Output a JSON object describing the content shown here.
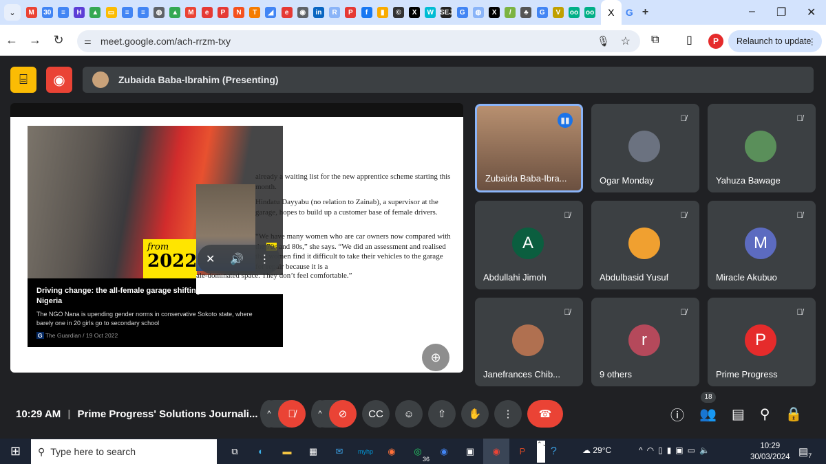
{
  "browser": {
    "tab_favicons": [
      {
        "icon": "gmail-icon",
        "glyph": "M",
        "color": "#ea4335"
      },
      {
        "icon": "calendar-icon",
        "glyph": "30",
        "color": "#4285f4"
      },
      {
        "icon": "docs-icon",
        "glyph": "≡",
        "color": "#4285f4"
      },
      {
        "icon": "app-icon",
        "glyph": "H",
        "color": "#5c3dd6"
      },
      {
        "icon": "drive-icon",
        "glyph": "▲",
        "color": "#34a853"
      },
      {
        "icon": "slides-icon",
        "glyph": "▭",
        "color": "#fbbc04"
      },
      {
        "icon": "docs-icon",
        "glyph": "≡",
        "color": "#4285f4"
      },
      {
        "icon": "docs-icon",
        "glyph": "≡",
        "color": "#4285f4"
      },
      {
        "icon": "globe-icon",
        "glyph": "◍",
        "color": "#5f6368"
      },
      {
        "icon": "drive-icon",
        "glyph": "▲",
        "color": "#34a853"
      },
      {
        "icon": "gmail-icon",
        "glyph": "M",
        "color": "#ea4335"
      },
      {
        "icon": "e-icon",
        "glyph": "e",
        "color": "#e53935"
      },
      {
        "icon": "p-icon",
        "glyph": "P",
        "color": "#e53935"
      },
      {
        "icon": "n-icon",
        "glyph": "N",
        "color": "#f4511e"
      },
      {
        "icon": "t-icon",
        "glyph": "T",
        "color": "#f57c00"
      },
      {
        "icon": "ads-icon",
        "glyph": "◢",
        "color": "#4285f4"
      },
      {
        "icon": "e-icon",
        "glyph": "e",
        "color": "#e53935"
      },
      {
        "icon": "chrome-icon",
        "glyph": "◉",
        "color": "#5f6368"
      },
      {
        "icon": "linkedin-icon",
        "glyph": "in",
        "color": "#0a66c2"
      },
      {
        "icon": "r-icon",
        "glyph": "R",
        "color": "#8ab4f8"
      },
      {
        "icon": "p-icon",
        "glyph": "P",
        "color": "#e53935"
      },
      {
        "icon": "facebook-icon",
        "glyph": "f",
        "color": "#1877f2"
      },
      {
        "icon": "analytics-icon",
        "glyph": "▮",
        "color": "#f9ab00"
      },
      {
        "icon": "c-icon",
        "glyph": "©",
        "color": "#333"
      },
      {
        "icon": "x-icon",
        "glyph": "X",
        "color": "#000"
      },
      {
        "icon": "bluesky-icon",
        "glyph": "W",
        "color": "#00bcd4"
      },
      {
        "icon": "sej-icon",
        "glyph": "SEJ",
        "color": "#222"
      },
      {
        "icon": "google-icon",
        "glyph": "G",
        "color": "#4285f4"
      },
      {
        "icon": "globe-icon",
        "glyph": "◍",
        "color": "#8ab4f8"
      },
      {
        "icon": "x-icon",
        "glyph": "X",
        "color": "#000"
      },
      {
        "icon": "pen-icon",
        "glyph": "/",
        "color": "#7cb342"
      },
      {
        "icon": "tree-icon",
        "glyph": "♣",
        "color": "#555"
      },
      {
        "icon": "google-icon",
        "glyph": "G",
        "color": "#4285f4"
      },
      {
        "icon": "v-icon",
        "glyph": "V",
        "color": "#c0a000"
      },
      {
        "icon": "tripadvisor-icon",
        "glyph": "oo",
        "color": "#00af87"
      },
      {
        "icon": "tripadvisor-icon",
        "glyph": "oo",
        "color": "#00af87"
      }
    ],
    "active_tab_close": "X",
    "next_tab_favicon": "G",
    "new_tab": "+",
    "url": "meet.google.com/ach-rrzm-txy",
    "relaunch_label": "Relaunch to update",
    "profile_initial": "P"
  },
  "meet": {
    "presenter_label": "Zubaida Baba-Ibrahim (Presenting)",
    "slide": {
      "badge_from": "from",
      "badge_year": "2022",
      "card_title": "Driving change: the all-female garage shifting attitudes in northern Nigeria",
      "card_desc": "The NGO Nana is upending gender norms in conservative Sokoto state, where barely one in 20 girls go to secondary school",
      "card_source": "The Guardian / 19 Oct 2022",
      "para1": "already a waiting list for the new apprentice scheme starting this month.",
      "para2": "Hindatu Dayyabu (no relation to Zainab), a supervisor at the garage, hopes to build up a customer base of female drivers.",
      "para3_a": "“We have many women who are car owners now compared with the ",
      "para3_highlight": "70s",
      "para3_b": " and 80s,” she says. “We did an assessment and realised that women find it difficult to take their vehicles to the garage for repair because it is a",
      "para3_c": "ale-dominated space. They don’t feel comfortable.”"
    },
    "participants": [
      {
        "name": "Zubaida Baba-Ibra...",
        "speaking": true,
        "avatar": "photo",
        "color": "#8a6a4a"
      },
      {
        "name": "Ogar Monday",
        "avatar": "photo",
        "color": "#6b7280"
      },
      {
        "name": "Yahuza Bawage",
        "avatar": "photo",
        "color": "#5a8f5a"
      },
      {
        "name": "Abdullahi Jimoh",
        "avatar": "A",
        "color": "#0b5e3f"
      },
      {
        "name": "Abdulbasid Yusuf",
        "avatar": "photo",
        "color": "#f0a030"
      },
      {
        "name": "Miracle Akubuo",
        "avatar": "M",
        "color": "#5c6bc0"
      },
      {
        "name": "Janefrances Chib...",
        "avatar": "photo",
        "color": "#b07050"
      },
      {
        "name": "9 others",
        "avatar": "r",
        "color": "#b5495b"
      },
      {
        "name": "Prime Progress",
        "avatar": "P",
        "color": "#e52b2b"
      }
    ],
    "time": "10:29 AM",
    "meeting_title": "Prime Progress' Solutions Journali...",
    "participant_count": "18"
  },
  "taskbar": {
    "search_placeholder": "Type here to search",
    "whatsapp_badge": "36",
    "weather": "29°C",
    "clock_time": "10:29",
    "clock_date": "30/03/2024",
    "notification_count": "7"
  },
  "colors": {
    "accent_red": "#ea4335",
    "meet_bg": "#202124",
    "tile_bg": "#3c4043",
    "speaking_border": "#8ab4f8"
  }
}
